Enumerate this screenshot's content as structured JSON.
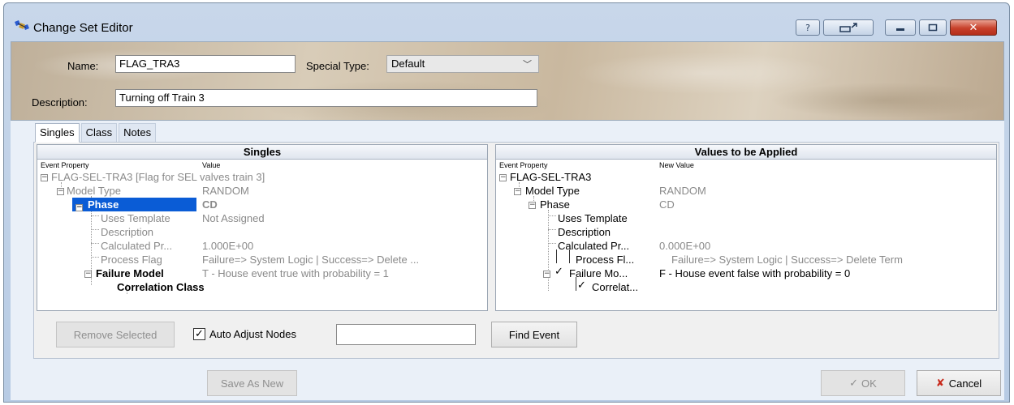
{
  "window": {
    "title": "Change Set Editor",
    "icons": [
      "app-satellite-icon",
      "help-icon",
      "restore-icon",
      "minimize-icon",
      "maximize-icon",
      "close-icon"
    ]
  },
  "header": {
    "name_label": "Name:",
    "name_value": "FLAG_TRA3",
    "special_type_label": "Special Type:",
    "special_type_value": "Default",
    "description_label": "Description:",
    "description_value": "Turning off Train 3"
  },
  "tabs": [
    "Singles",
    "Class",
    "Notes"
  ],
  "singles_panel": {
    "title": "Singles",
    "col_property": "Event Property",
    "col_value": "Value",
    "rows": [
      {
        "label": "FLAG-SEL-TRA3  [Flag for SEL valves train 3]",
        "value": ""
      },
      {
        "label": "Model Type",
        "value": "RANDOM"
      },
      {
        "label": "Phase",
        "value": "CD"
      },
      {
        "label": "Uses Template",
        "value": "Not Assigned"
      },
      {
        "label": "Description",
        "value": ""
      },
      {
        "label": "Calculated Pr...",
        "value": "1.000E+00"
      },
      {
        "label": "Process Flag",
        "value": "Failure=> System Logic    | Success=> Delete ..."
      },
      {
        "label": "Failure Model",
        "value": "T - House event true with probability = 1"
      },
      {
        "label": "Correlation Class",
        "value": ""
      }
    ]
  },
  "applied_panel": {
    "title": "Values to be Applied",
    "col_property": "Event Property",
    "col_value": "New Value",
    "rows": [
      {
        "label": "FLAG-SEL-TRA3",
        "value": ""
      },
      {
        "label": "Model Type",
        "value": "RANDOM"
      },
      {
        "label": "Phase",
        "value": "CD"
      },
      {
        "label": "Uses Template",
        "value": ""
      },
      {
        "label": "Description",
        "value": ""
      },
      {
        "label": "Calculated Pr...",
        "value": "0.000E+00"
      },
      {
        "label": "Process Fl...",
        "value": "Failure=> System Logic    | Success=> Delete Term"
      },
      {
        "label": "Failure Mo...",
        "value": "F - House event false with probability = 0"
      },
      {
        "label": "Correlat...",
        "value": ""
      }
    ]
  },
  "controls": {
    "remove_selected": "Remove Selected",
    "auto_adjust_label": "Auto Adjust Nodes",
    "auto_adjust_checked": true,
    "find_input_value": "",
    "find_event": "Find Event"
  },
  "footer": {
    "save_as_new": "Save As New",
    "ok": "OK",
    "cancel": "Cancel"
  }
}
